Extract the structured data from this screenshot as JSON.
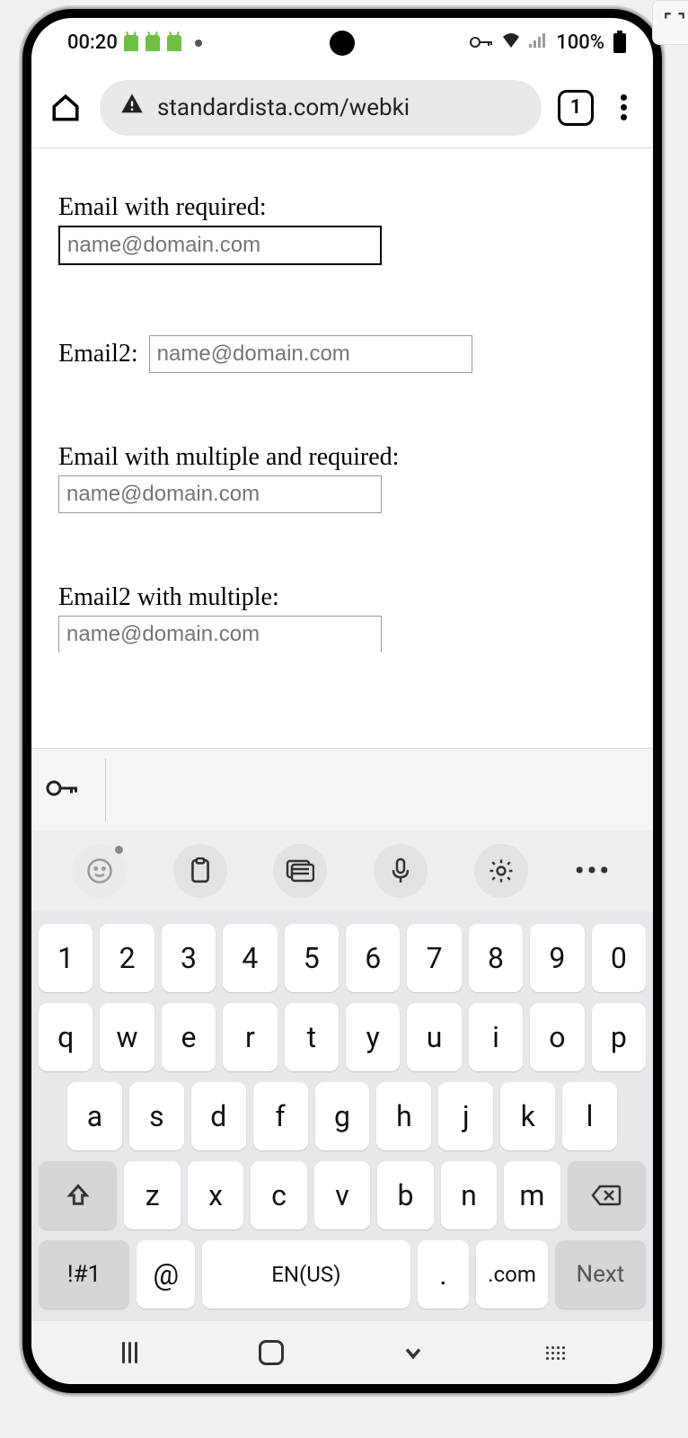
{
  "status": {
    "time": "00:20",
    "battery_pct": "100%"
  },
  "browser": {
    "url": "standardista.com/webki",
    "tab_count": "1"
  },
  "form": {
    "fields": [
      {
        "label": "Email with required:",
        "placeholder": "name@domain.com",
        "focused": true,
        "inline": false
      },
      {
        "label": "Email2:",
        "placeholder": "name@domain.com",
        "focused": false,
        "inline": true
      },
      {
        "label": "Email with multiple and required:",
        "placeholder": "name@domain.com",
        "focused": false,
        "inline": false
      },
      {
        "label": "Email2 with multiple:",
        "placeholder": "name@domain.com",
        "focused": false,
        "inline": false
      }
    ]
  },
  "keyboard": {
    "row1": [
      "1",
      "2",
      "3",
      "4",
      "5",
      "6",
      "7",
      "8",
      "9",
      "0"
    ],
    "row2": [
      "q",
      "w",
      "e",
      "r",
      "t",
      "y",
      "u",
      "i",
      "o",
      "p"
    ],
    "row3": [
      "a",
      "s",
      "d",
      "f",
      "g",
      "h",
      "j",
      "k",
      "l"
    ],
    "row4": [
      "z",
      "x",
      "c",
      "v",
      "b",
      "n",
      "m"
    ],
    "sym_key": "!#1",
    "at_key": "@",
    "space_label": "EN(US)",
    "dot_key": ".",
    "com_key": ".com",
    "next_label": "Next"
  }
}
